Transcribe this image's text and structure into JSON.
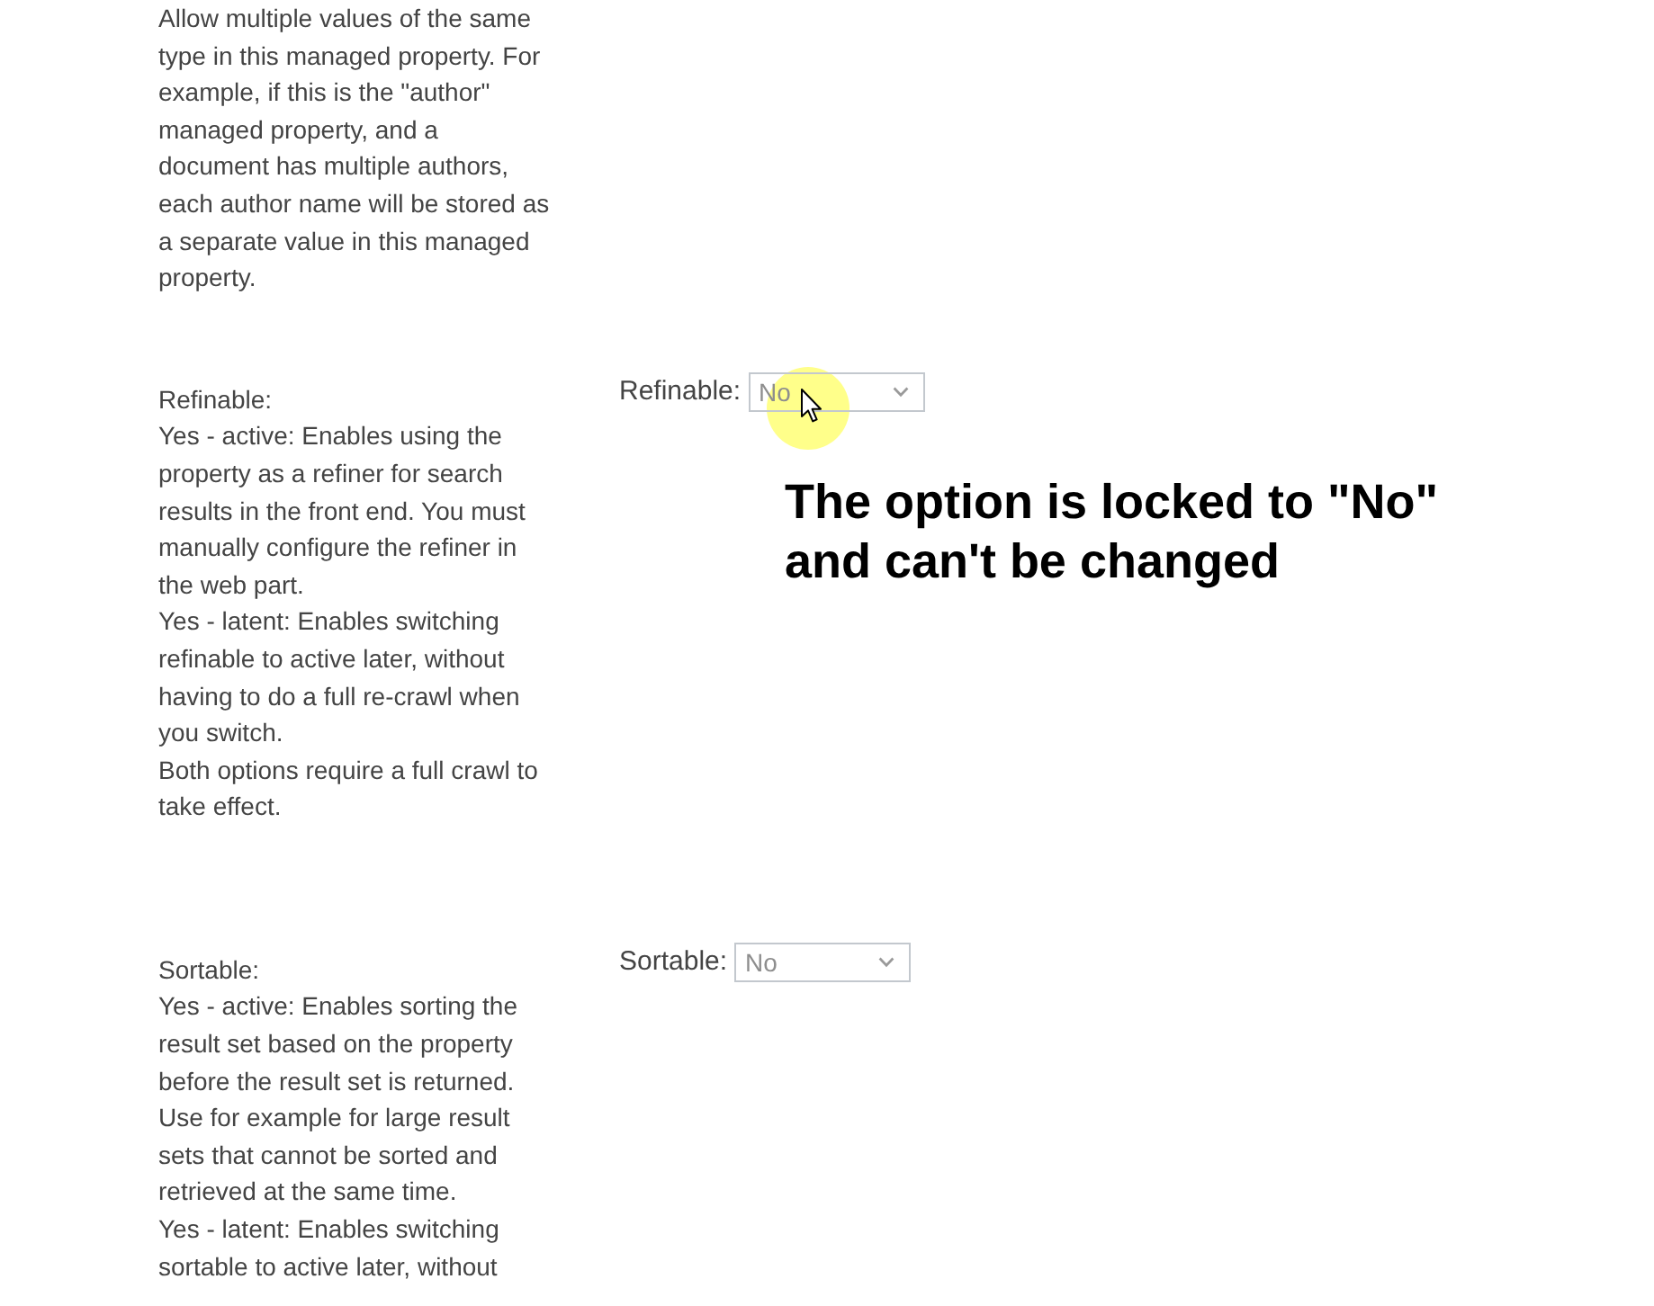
{
  "sections": [
    {
      "description": [
        "Allow multiple values of the same type in this managed property. For example, if this is the \"author\" managed property, and a document has multiple authors, each author name will be stored as a separate value in this managed property."
      ]
    },
    {
      "description": [
        "Refinable:",
        "Yes - active: Enables using the property as a refiner for search results in the front end. You must manually configure the refiner in the web part.",
        "Yes - latent: Enables switching refinable to active later, without having to do a full re-crawl when you switch.",
        "Both options require a full crawl to take effect."
      ],
      "field": {
        "label": "Refinable:",
        "value": "No",
        "disabled": true,
        "pointer": true
      },
      "annotation": "The option is locked to \"No\" and can't be changed"
    },
    {
      "description": [
        "Sortable:",
        "Yes - active: Enables sorting the result set based on the property before the result set is returned. Use for example for large result sets that cannot be sorted and retrieved at the same time.",
        "Yes - latent: Enables switching sortable to active later, without"
      ],
      "field": {
        "label": "Sortable:",
        "value": "No",
        "disabled": true,
        "pointer": false
      }
    }
  ]
}
